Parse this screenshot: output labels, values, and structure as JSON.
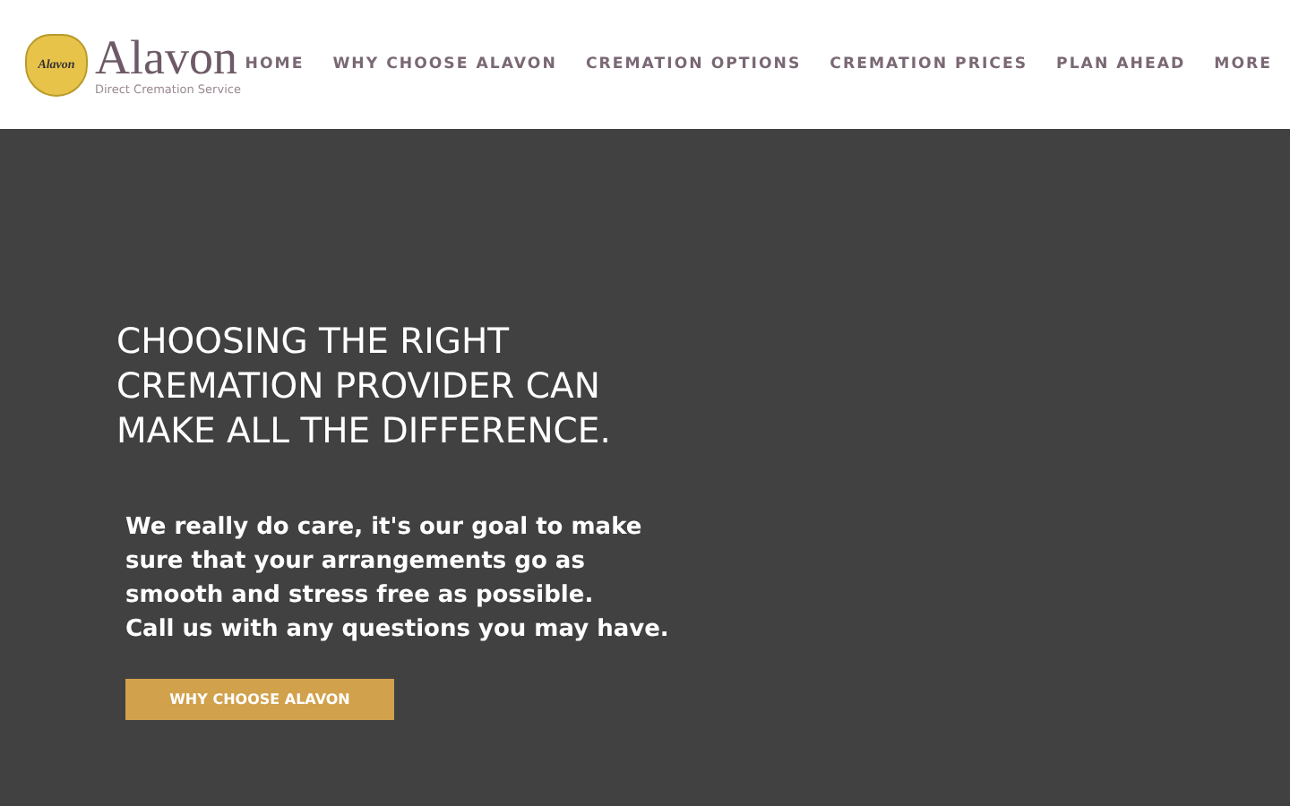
{
  "logo": {
    "badge_title": "Alavon",
    "name": "Alavon",
    "tagline": "Direct Cremation Service"
  },
  "nav": [
    {
      "label": "HOME"
    },
    {
      "label": "WHY CHOOSE ALAVON"
    },
    {
      "label": "CREMATION OPTIONS"
    },
    {
      "label": "CREMATION PRICES"
    },
    {
      "label": "PLAN AHEAD"
    },
    {
      "label": "MORE"
    }
  ],
  "hero": {
    "headline": "CHOOSING THE RIGHT CREMATION PROVIDER CAN MAKE ALL THE DIFFERENCE.",
    "lines": [
      "We really do care, it's our goal to make",
      "sure that your arrangements go as",
      "smooth and stress free as possible.",
      "Call us with any questions you may have."
    ],
    "button": "WHY CHOOSE ALAVON"
  }
}
